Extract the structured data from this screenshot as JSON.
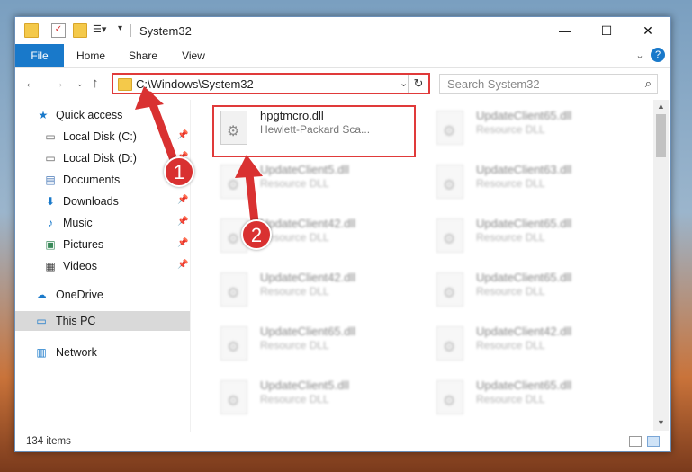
{
  "window": {
    "title": "System32",
    "quick_access_icons": [
      "folder-icon",
      "properties-icon",
      "new-folder-icon",
      "customize-icon"
    ]
  },
  "ribbon": {
    "tabs": [
      "File",
      "Home",
      "Share",
      "View"
    ]
  },
  "nav": {
    "address_path": "C:\\Windows\\System32",
    "search_placeholder": "Search System32"
  },
  "sidebar": {
    "items": [
      {
        "label": "Quick access",
        "icon": "star-icon",
        "pinned": false
      },
      {
        "label": "Local Disk (C:)",
        "icon": "drive-icon",
        "pinned": true
      },
      {
        "label": "Local Disk (D:)",
        "icon": "drive-icon",
        "pinned": true
      },
      {
        "label": "Documents",
        "icon": "documents-icon",
        "pinned": true
      },
      {
        "label": "Downloads",
        "icon": "downloads-icon",
        "pinned": true
      },
      {
        "label": "Music",
        "icon": "music-icon",
        "pinned": true
      },
      {
        "label": "Pictures",
        "icon": "pictures-icon",
        "pinned": true
      },
      {
        "label": "Videos",
        "icon": "videos-icon",
        "pinned": true
      },
      {
        "label": "OneDrive",
        "icon": "cloud-icon",
        "pinned": false
      },
      {
        "label": "This PC",
        "icon": "computer-icon",
        "pinned": false,
        "selected": true
      },
      {
        "label": "Network",
        "icon": "network-icon",
        "pinned": false
      }
    ]
  },
  "files": [
    {
      "name": "hpgtmcro.dll",
      "desc": "Hewlett-Packard Sca...",
      "highlight": true
    },
    {
      "name": "UpdateClient65.dll",
      "desc": "Resource DLL"
    },
    {
      "name": "UpdateClient5.dll",
      "desc": "Resource DLL"
    },
    {
      "name": "UpdateClient63.dll",
      "desc": "Resource DLL"
    },
    {
      "name": "UpdateClient42.dll",
      "desc": "Resource DLL"
    },
    {
      "name": "UpdateClient65.dll",
      "desc": "Resource DLL"
    },
    {
      "name": "UpdateClient42.dll",
      "desc": "Resource DLL"
    },
    {
      "name": "UpdateClient65.dll",
      "desc": "Resource DLL"
    },
    {
      "name": "UpdateClient65.dll",
      "desc": "Resource DLL"
    },
    {
      "name": "UpdateClient42.dll",
      "desc": "Resource DLL"
    },
    {
      "name": "UpdateClient5.dll",
      "desc": "Resource DLL"
    },
    {
      "name": "UpdateClient65.dll",
      "desc": "Resource DLL"
    }
  ],
  "status": {
    "item_count": "134 items"
  },
  "callouts": [
    "1",
    "2"
  ],
  "colors": {
    "accent": "#1979ca",
    "highlight": "#e03a3a",
    "callout": "#d93131"
  }
}
